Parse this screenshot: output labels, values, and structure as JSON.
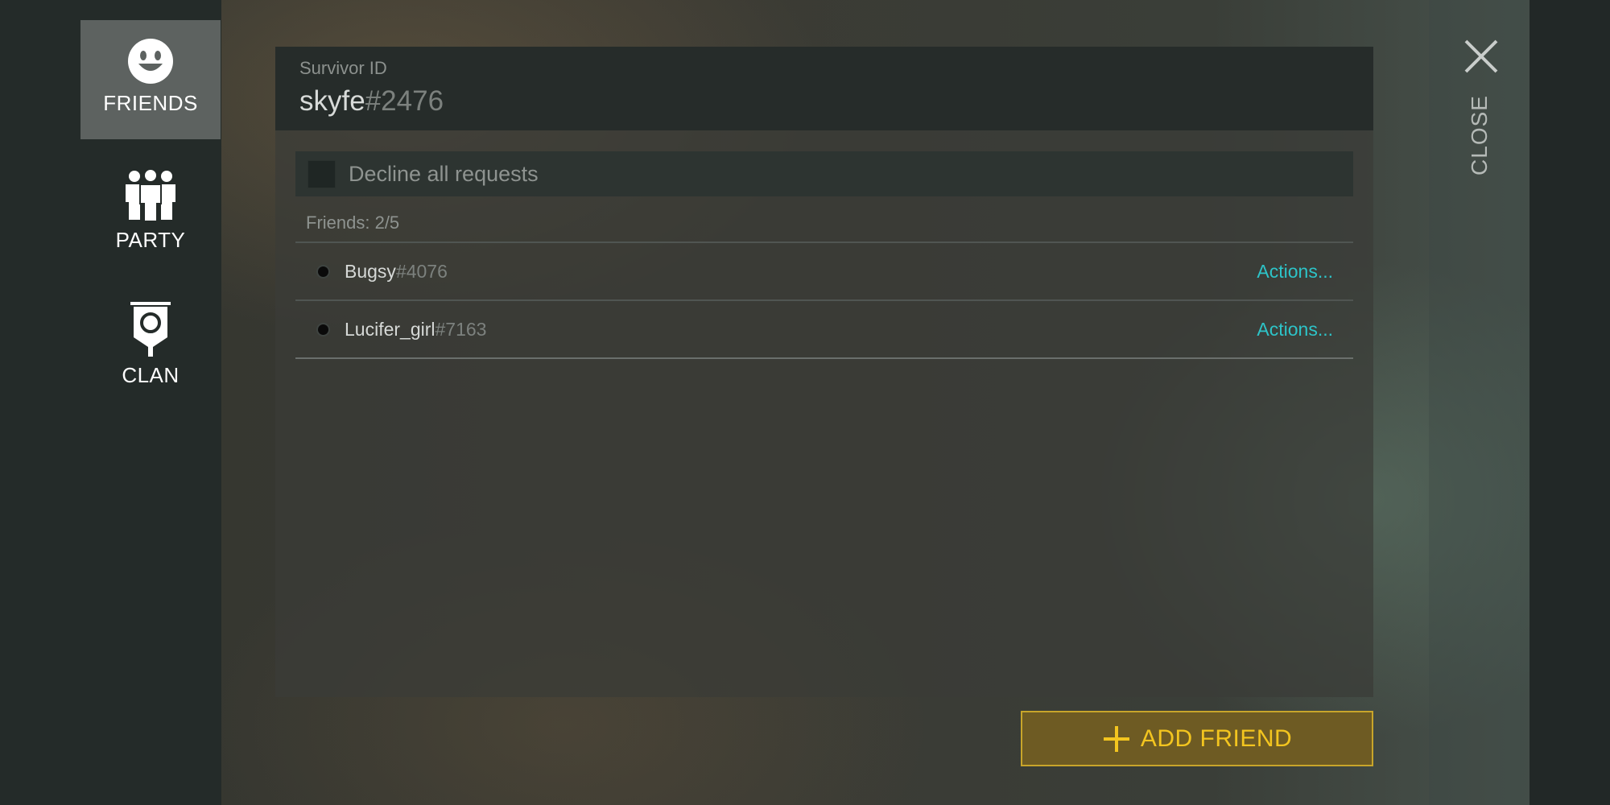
{
  "sidebar": {
    "items": [
      {
        "label": "FRIENDS",
        "icon": "smiley-face-icon",
        "active": true
      },
      {
        "label": "PARTY",
        "icon": "group-people-icon",
        "active": false
      },
      {
        "label": "CLAN",
        "icon": "clan-banner-icon",
        "active": false
      }
    ]
  },
  "header": {
    "survivor_id_label": "Survivor ID",
    "username": "skyfe",
    "tag": "#2476"
  },
  "decline_all": {
    "label": "Decline all requests",
    "checked": false
  },
  "friends": {
    "count_label": "Friends: 2/5",
    "list": [
      {
        "name": "Bugsy",
        "tag": "#4076",
        "action_label": "Actions..."
      },
      {
        "name": "Lucifer_girl",
        "tag": "#7163",
        "action_label": "Actions..."
      }
    ]
  },
  "add_friend": {
    "label": "ADD FRIEND",
    "icon": "plus-icon"
  },
  "close": {
    "label": "CLOSE",
    "icon": "close-icon"
  },
  "colors": {
    "accent_cyan": "#2dc4c8",
    "add_button_bg": "#6e5b23",
    "add_button_text": "#f3c51f",
    "sidebar_active": "#5d6260"
  }
}
